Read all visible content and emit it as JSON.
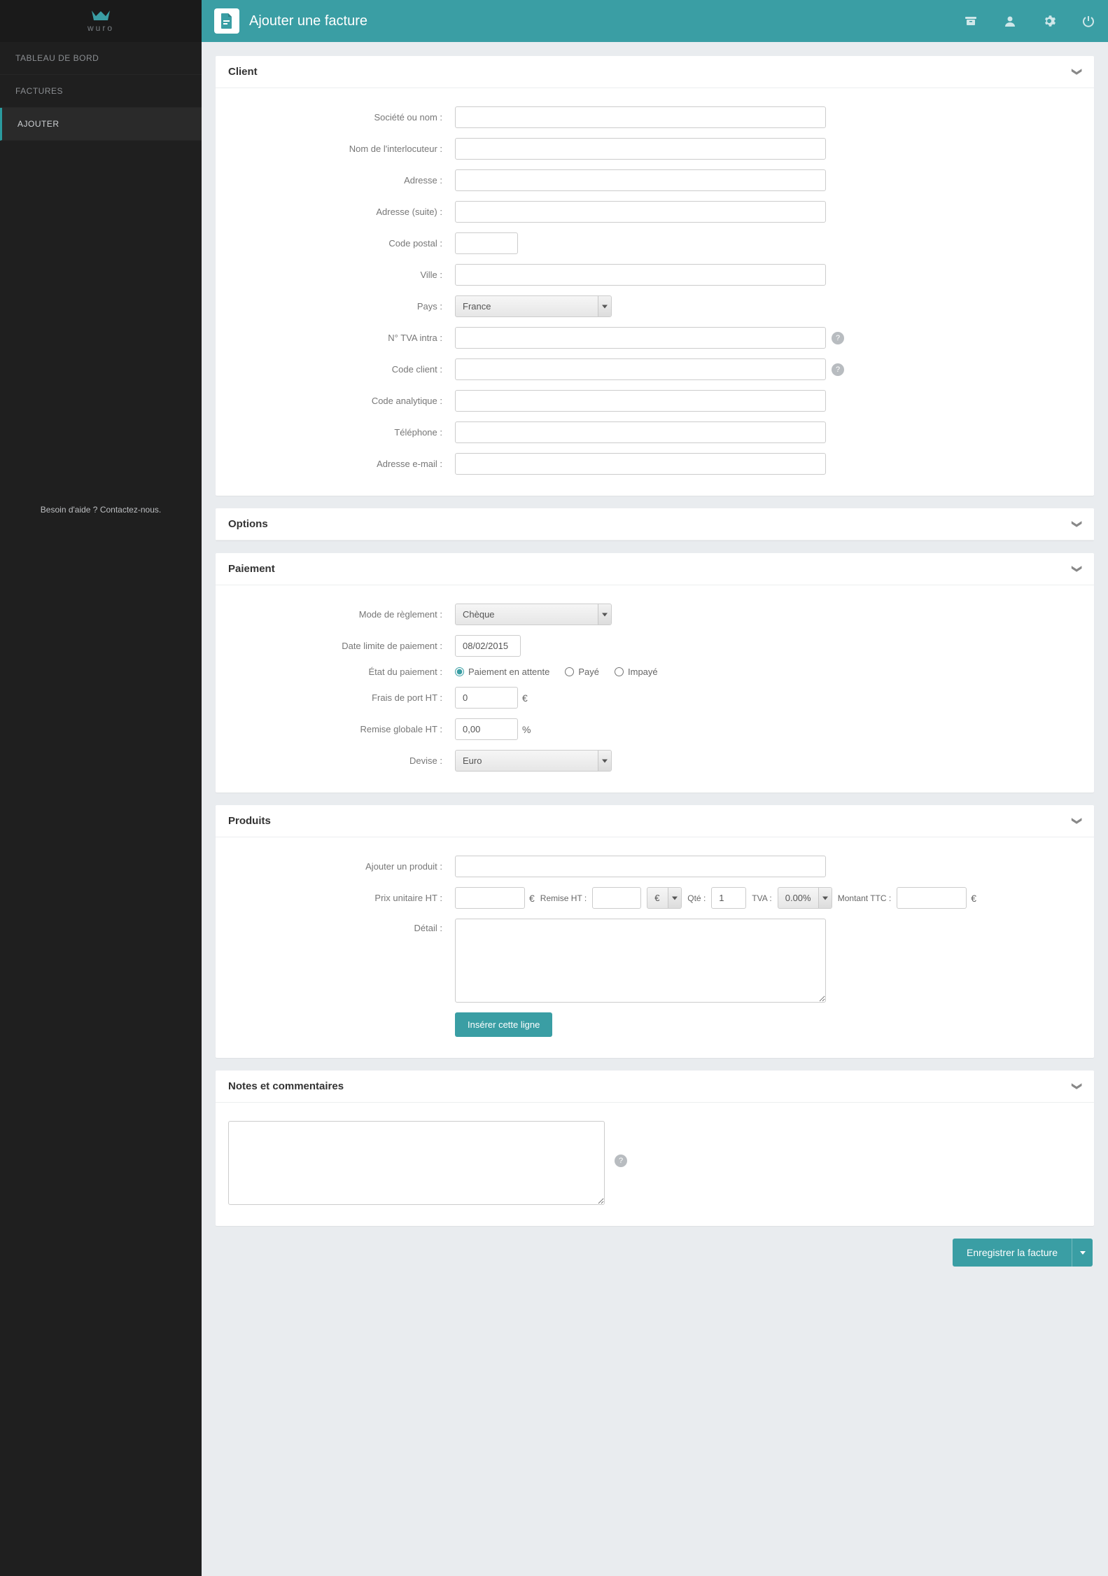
{
  "app": {
    "logo_text": "wuro",
    "title": "Ajouter une facture",
    "help_footer": "Besoin d'aide ? Contactez-nous."
  },
  "nav": {
    "dashboard": "TABLEAU DE BORD",
    "invoices": "FACTURES",
    "add": "AJOUTER"
  },
  "panels": {
    "client": {
      "title": "Client"
    },
    "options": {
      "title": "Options"
    },
    "payment": {
      "title": "Paiement"
    },
    "products": {
      "title": "Produits"
    },
    "notes": {
      "title": "Notes et commentaires"
    }
  },
  "client": {
    "labels": {
      "company": "Société ou nom :",
      "contact": "Nom de l'interlocuteur :",
      "address": "Adresse :",
      "address2": "Adresse (suite) :",
      "postal": "Code postal :",
      "city": "Ville :",
      "country": "Pays :",
      "vat": "N° TVA intra :",
      "client_code": "Code client :",
      "analytic_code": "Code analytique :",
      "phone": "Téléphone :",
      "email": "Adresse e-mail :"
    },
    "values": {
      "country": "France"
    },
    "help_char": "?"
  },
  "payment": {
    "labels": {
      "mode": "Mode de règlement :",
      "due_date": "Date limite de paiement :",
      "status": "État du paiement :",
      "shipping": "Frais de port HT :",
      "discount": "Remise globale HT :",
      "currency": "Devise :"
    },
    "values": {
      "mode": "Chèque",
      "due_date": "08/02/2015",
      "shipping": "0",
      "discount": "0,00",
      "currency": "Euro"
    },
    "status_options": {
      "pending": "Paiement en attente",
      "paid": "Payé",
      "unpaid": "Impayé"
    },
    "suffix": {
      "euro": "€",
      "percent": "%"
    }
  },
  "products": {
    "labels": {
      "add_product": "Ajouter un produit :",
      "unit_price": "Prix unitaire HT :",
      "discount": "Remise HT :",
      "qty": "Qté :",
      "vat": "TVA :",
      "total_ttc": "Montant TTC :",
      "detail": "Détail :"
    },
    "values": {
      "discount_unit": "€",
      "qty": "1",
      "vat": "0.00%"
    },
    "insert_button": "Insérer cette ligne",
    "suffix": {
      "euro": "€"
    }
  },
  "notes": {
    "help_char": "?"
  },
  "save": {
    "label": "Enregistrer la facture"
  }
}
